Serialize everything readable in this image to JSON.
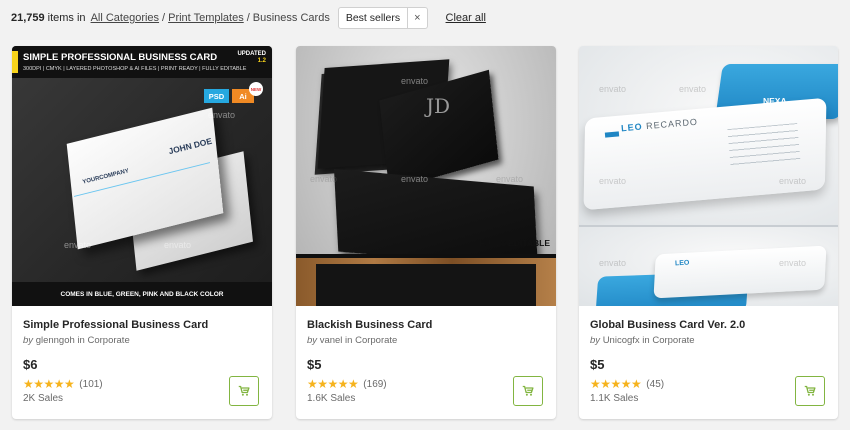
{
  "toolbar": {
    "count": "21,759",
    "items_in": "items in",
    "breadcrumbs": [
      "All Categories",
      "Print Templates",
      "Business Cards"
    ],
    "separator": "/",
    "filter_chip": "Best sellers",
    "chip_close": "×",
    "clear_all": "Clear all"
  },
  "items": [
    {
      "title": "Simple Professional Business Card",
      "by": "by",
      "author": "glenngoh",
      "in": "in",
      "category": "Corporate",
      "price": "$6",
      "stars": "★★★★★",
      "rating_value": 4.5,
      "reviews": "(101)",
      "sales": "2K Sales",
      "thumb": {
        "header_title": "SIMPLE PROFESSIONAL BUSINESS CARD",
        "header_sub": "300DPI | CMYK | LAYERED PHOTOSHOP & AI FILES | PRINT READY | FULLY EDITABLE",
        "updated": "UPDATED",
        "version": "1.2",
        "badge_psd": "PSD",
        "badge_ai": "Ai",
        "badge_new": "NEW",
        "card_name": "JOHN DOE",
        "card_company": "YOURCOMPANY",
        "footer": "COMES IN BLUE, GREEN, PINK AND BLACK COLOR",
        "watermark": "envato"
      }
    },
    {
      "title": "Blackish Business Card",
      "by": "by",
      "author": "vanel",
      "in": "in",
      "category": "Corporate",
      "price": "$5",
      "stars": "★★★★★",
      "rating_value": 4.5,
      "reviews": "(169)",
      "sales": "1.6K Sales",
      "thumb": {
        "monogram": "JD",
        "editable": "FULLY EDITABLE",
        "watermark": "envato"
      }
    },
    {
      "title": "Global Business Card Ver. 2.0",
      "by": "by",
      "author": "Unicogfx",
      "in": "in",
      "category": "Corporate",
      "price": "$5",
      "stars": "★★★★★",
      "rating_value": 4.5,
      "reviews": "(45)",
      "sales": "1.1K Sales",
      "thumb": {
        "brand": "NEXA",
        "name_first": "LEO",
        "name_last": "RECARDO",
        "watermark": "envato"
      }
    }
  ],
  "colors": {
    "star": "#f6b31d",
    "cart_accent": "#82b541",
    "background": "#f2f2f2"
  },
  "icons": {
    "cart": "cart-icon",
    "close": "close-icon",
    "watermark": "envato-logo"
  }
}
